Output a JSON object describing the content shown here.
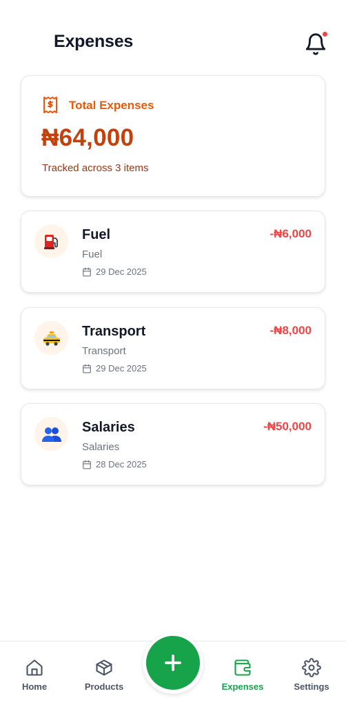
{
  "header": {
    "title": "Expenses",
    "notification_icon": "bell-icon",
    "has_unread": true
  },
  "summary": {
    "icon": "receipt-icon",
    "label": "Total Expenses",
    "amount": "₦64,000",
    "subtitle": "Tracked across 3 items",
    "accent_color": "#ea580c"
  },
  "expenses": [
    {
      "emoji": "⛽",
      "icon": "fuel-pump-icon",
      "title": "Fuel",
      "category": "Fuel",
      "date": "29 Dec 2025",
      "amount": "-₦6,000"
    },
    {
      "emoji": "🚕",
      "icon": "taxi-icon",
      "title": "Transport",
      "category": "Transport",
      "date": "29 Dec 2025",
      "amount": "-₦8,000"
    },
    {
      "emoji": "👥",
      "icon": "people-icon",
      "title": "Salaries",
      "category": "Salaries",
      "date": "28 Dec 2025",
      "amount": "-₦50,000"
    }
  ],
  "nav": {
    "items": [
      {
        "label": "Home",
        "icon": "home-icon",
        "active": false
      },
      {
        "label": "Products",
        "icon": "box-icon",
        "active": false
      },
      {
        "label": "Expenses",
        "icon": "wallet-icon",
        "active": true
      },
      {
        "label": "Settings",
        "icon": "gear-icon",
        "active": false
      }
    ],
    "fab_icon": "plus-icon",
    "active_color": "#16a34a"
  }
}
